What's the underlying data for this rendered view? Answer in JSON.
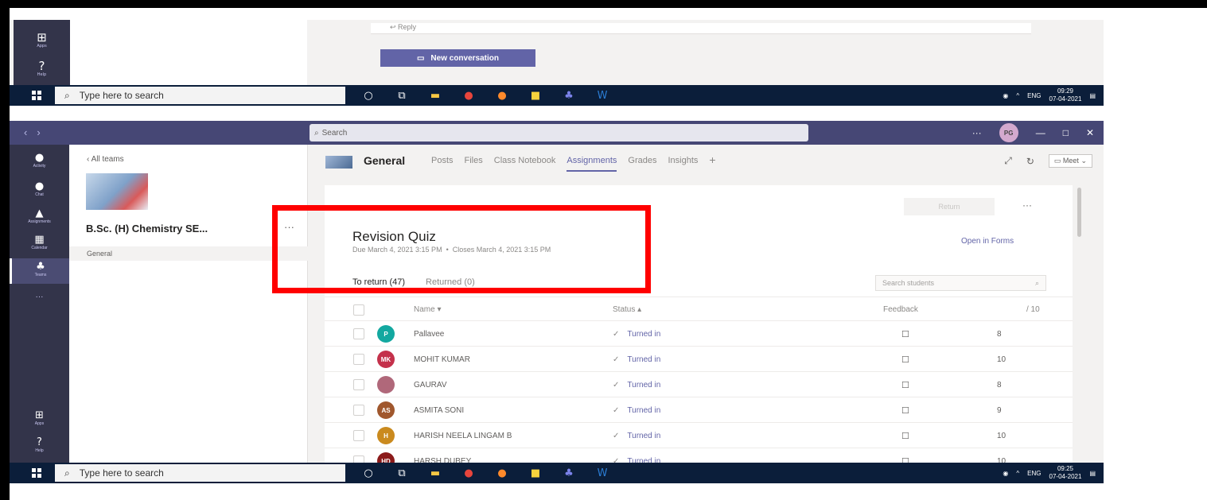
{
  "top_screenshot": {
    "rail": [
      {
        "label": "Apps",
        "icon": "apps-icon",
        "glyph": "⊞"
      },
      {
        "label": "Help",
        "icon": "help-icon",
        "glyph": "?"
      }
    ],
    "reply_label": "Reply",
    "new_conversation_label": "New conversation"
  },
  "taskbar": {
    "search_placeholder": "Type here to search",
    "apps": [
      "cortana-icon",
      "task-view-icon",
      "file-explorer-icon",
      "chrome-icon",
      "firefox-icon",
      "sticky-notes-icon",
      "teams-icon",
      "word-icon"
    ],
    "language": "ENG",
    "top_clock": {
      "time": "09:29",
      "date": "07-04-2021"
    },
    "bottom_clock": {
      "time": "09:25",
      "date": "07-04-2021"
    }
  },
  "titlebar": {
    "search_placeholder": "Search",
    "more_label": "···",
    "avatar_initials": "PG"
  },
  "rail": [
    {
      "label": "Activity",
      "icon": "bell-icon",
      "glyph": "🔔"
    },
    {
      "label": "Chat",
      "icon": "chat-icon",
      "glyph": "💬"
    },
    {
      "label": "Assignments",
      "icon": "assignments-icon",
      "glyph": "🎒"
    },
    {
      "label": "Calendar",
      "icon": "calendar-icon",
      "glyph": "▦"
    },
    {
      "label": "Teams",
      "icon": "teams-icon",
      "glyph": "👥",
      "active": true
    },
    {
      "label": "···",
      "icon": "more-icon",
      "glyph": ""
    },
    {
      "label": "Apps",
      "icon": "apps-icon",
      "glyph": "⊞"
    },
    {
      "label": "Help",
      "icon": "help-icon",
      "glyph": "?"
    }
  ],
  "teams_pane": {
    "all_teams_label": "All teams",
    "team_name": "B.Sc. (H) Chemistry SE...",
    "more_label": "···",
    "channel": "General"
  },
  "channel_header": {
    "name": "General",
    "tabs": [
      "Posts",
      "Files",
      "Class Notebook",
      "Assignments",
      "Grades",
      "Insights"
    ],
    "active_tab": "Assignments",
    "add_tab": "+",
    "meet_label": "Meet"
  },
  "assignment": {
    "return_label": "Return",
    "more_label": "···",
    "title": "Revision Quiz",
    "due": "Due March 4, 2021 3:15 PM",
    "closes": "Closes March 4, 2021 3:15 PM",
    "open_in_forms": "Open in Forms",
    "tabs": [
      {
        "label": "To return (47)",
        "active": true
      },
      {
        "label": "Returned (0)",
        "active": false
      }
    ],
    "search_placeholder": "Search students",
    "columns": {
      "name": "Name",
      "status": "Status",
      "feedback": "Feedback",
      "points": "/ 10"
    },
    "rows": [
      {
        "initials": "P",
        "name": "Pallavee",
        "status": "Turned in",
        "points": "8",
        "color": "#13a8a0"
      },
      {
        "initials": "MK",
        "name": "MOHIT KUMAR",
        "status": "Turned in",
        "points": "10",
        "color": "#c4314b"
      },
      {
        "initials": "",
        "name": "GAURAV",
        "status": "Turned in",
        "points": "8",
        "color": "#b0687a"
      },
      {
        "initials": "AS",
        "name": "ASMITA SONI",
        "status": "Turned in",
        "points": "9",
        "color": "#a0572d"
      },
      {
        "initials": "H",
        "name": "HARISH NEELA LINGAM B",
        "status": "Turned in",
        "points": "10",
        "color": "#ca8a1e"
      },
      {
        "initials": "HD",
        "name": "HARSH DUBEY",
        "status": "Turned in",
        "points": "10",
        "color": "#8b1a1a"
      }
    ]
  },
  "colors": {
    "accent": "#6264a7",
    "rail": "#33344a",
    "titlebar": "#464775",
    "taskbar": "#0b1e3a",
    "highlight": "#ff0000"
  }
}
